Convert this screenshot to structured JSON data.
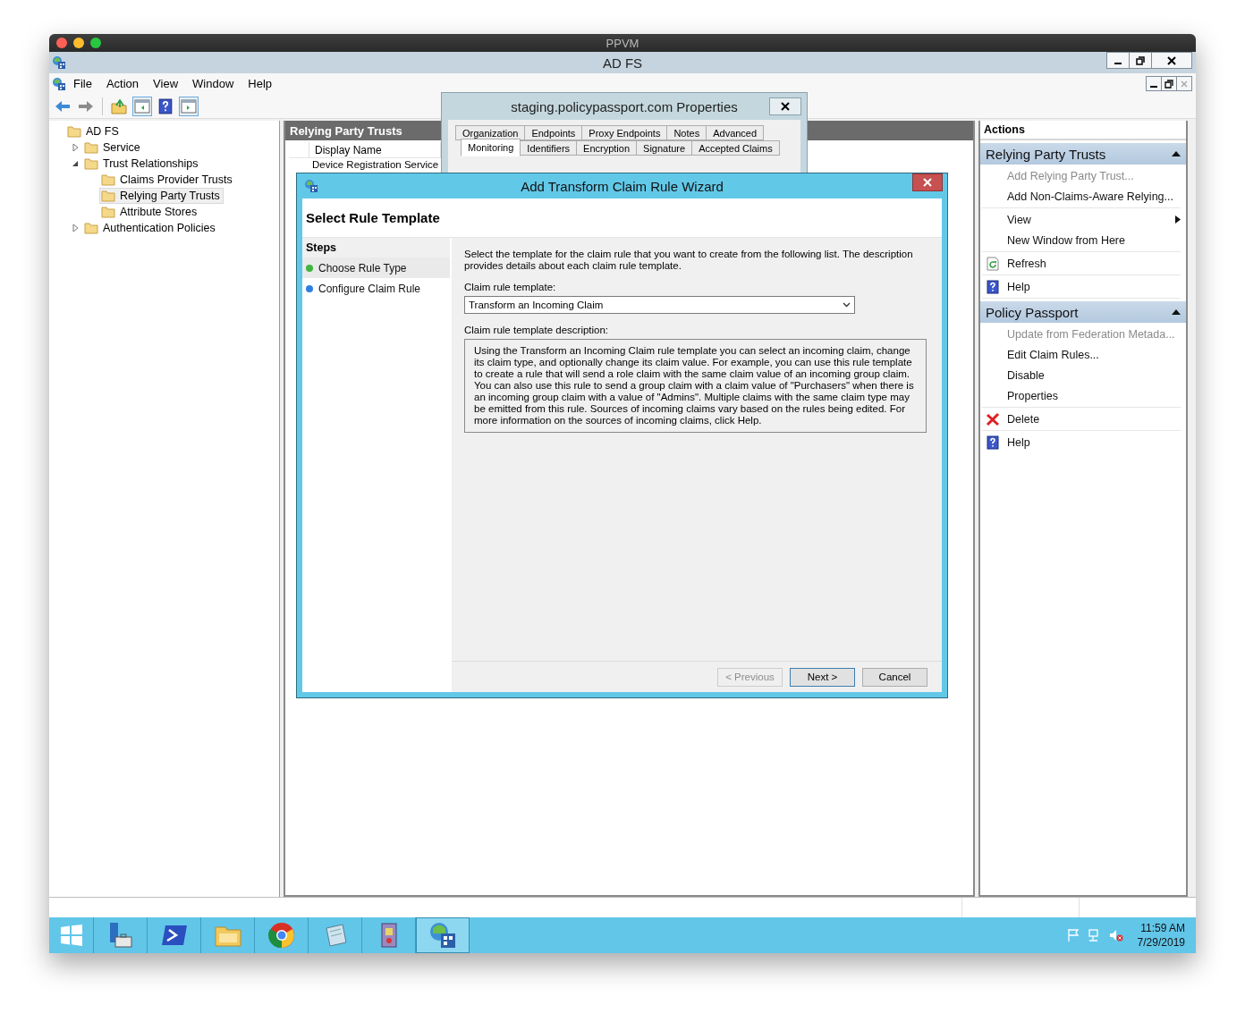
{
  "host_window": {
    "title": "PPVM"
  },
  "window": {
    "title": "AD FS"
  },
  "menu": [
    "File",
    "Action",
    "View",
    "Window",
    "Help"
  ],
  "tree": [
    {
      "label": "AD FS",
      "selected": false,
      "children": [
        {
          "label": "Service",
          "selected": false,
          "expanded": false
        },
        {
          "label": "Trust Relationships",
          "selected": false,
          "expanded": true,
          "children": [
            {
              "label": "Claims Provider Trusts",
              "selected": false
            },
            {
              "label": "Relying Party Trusts",
              "selected": true
            },
            {
              "label": "Attribute Stores",
              "selected": false
            }
          ]
        },
        {
          "label": "Authentication Policies",
          "selected": false,
          "expanded": false
        }
      ]
    }
  ],
  "center": {
    "title": "Relying Party Trusts",
    "columns": [
      "Display Name"
    ],
    "rows": [
      "Device Registration Service"
    ]
  },
  "properties_dialog": {
    "title": "staging.policypassport.com Properties",
    "tab_rows": [
      [
        {
          "label": "Organization",
          "selected": false
        },
        {
          "label": "Endpoints",
          "selected": false
        },
        {
          "label": "Proxy Endpoints",
          "selected": false
        },
        {
          "label": "Notes",
          "selected": false
        },
        {
          "label": "Advanced",
          "selected": false
        }
      ],
      [
        {
          "label": "Monitoring",
          "selected": true
        },
        {
          "label": "Identifiers",
          "selected": false
        },
        {
          "label": "Encryption",
          "selected": false
        },
        {
          "label": "Signature",
          "selected": false
        },
        {
          "label": "Accepted Claims",
          "selected": false
        }
      ]
    ]
  },
  "wizard": {
    "title": "Add Transform Claim Rule Wizard",
    "heading": "Select Rule Template",
    "steps_title": "Steps",
    "steps": [
      {
        "label": "Choose Rule Type",
        "selected": true,
        "color": "#3fb53f"
      },
      {
        "label": "Configure Claim Rule",
        "selected": false,
        "color": "#2f7fe0"
      }
    ],
    "intro": "Select the template for the claim rule that you want to create from the following list. The description provides details about each claim rule template.",
    "template_label": "Claim rule template:",
    "template_value": "Transform an Incoming Claim",
    "description_label": "Claim rule template description:",
    "description": "Using the Transform an Incoming Claim rule template you can select an incoming claim, change its claim type, and optionally change its claim value.  For example, you can use this rule template to create a rule that will send a role claim with the same claim value of an incoming group claim.  You can also use this rule to send a group claim with a claim value of \"Purchasers\" when there is an incoming group claim with a value of \"Admins\".  Multiple claims with the same claim type may be emitted from this rule.  Sources of incoming claims vary based on the rules being edited.  For more information on the sources of incoming claims, click Help.",
    "buttons": [
      {
        "label": "< Previous",
        "disabled": true,
        "default": false
      },
      {
        "label": "Next >",
        "disabled": false,
        "default": true
      },
      {
        "label": "Cancel",
        "disabled": false,
        "default": false
      }
    ]
  },
  "actions": {
    "title": "Actions",
    "sections": [
      {
        "title": "Relying Party Trusts",
        "expanded": true,
        "groups": [
          [
            {
              "label": "Add Relying Party Trust...",
              "disabled": true,
              "kind": "plain"
            },
            {
              "label": "Add Non-Claims-Aware Relying...",
              "disabled": false,
              "kind": "plain"
            }
          ],
          [
            {
              "label": "View",
              "disabled": false,
              "kind": "submenu"
            },
            {
              "label": "New Window from Here",
              "disabled": false,
              "kind": "plain"
            }
          ],
          [
            {
              "label": "Refresh",
              "disabled": false,
              "kind": "refresh"
            }
          ],
          [
            {
              "label": "Help",
              "disabled": false,
              "kind": "help"
            }
          ]
        ]
      },
      {
        "title": "Policy Passport",
        "expanded": true,
        "groups": [
          [
            {
              "label": "Update from Federation Metada...",
              "disabled": true,
              "kind": "plain"
            },
            {
              "label": "Edit Claim Rules...",
              "disabled": false,
              "kind": "plain"
            },
            {
              "label": "Disable",
              "disabled": false,
              "kind": "plain"
            },
            {
              "label": "Properties",
              "disabled": false,
              "kind": "plain"
            }
          ],
          [
            {
              "label": "Delete",
              "disabled": false,
              "kind": "delete"
            }
          ],
          [
            {
              "label": "Help",
              "disabled": false,
              "kind": "help"
            }
          ]
        ]
      }
    ]
  },
  "taskbar": {
    "apps": [
      {
        "kind": "start",
        "selected": false
      },
      {
        "kind": "server-manager",
        "selected": false
      },
      {
        "kind": "powershell",
        "selected": false
      },
      {
        "kind": "explorer",
        "selected": false
      },
      {
        "kind": "browser",
        "selected": false
      },
      {
        "kind": "notepad",
        "selected": false
      },
      {
        "kind": "book",
        "selected": false
      },
      {
        "kind": "adfs",
        "selected": true
      }
    ],
    "time": "11:59 AM",
    "date": "7/29/2019"
  }
}
